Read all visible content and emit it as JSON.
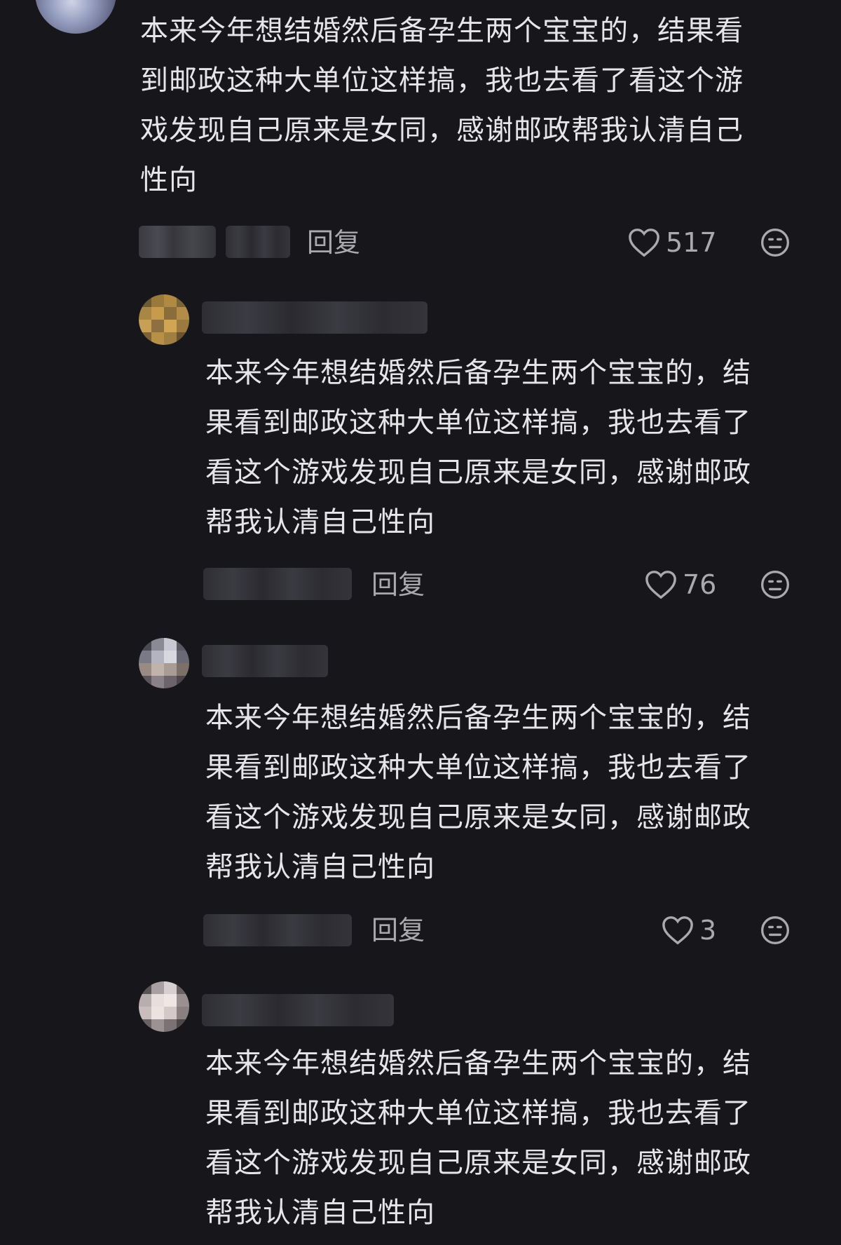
{
  "comments": [
    {
      "text": "本来今年想结婚然后备孕生两个宝宝的，结果看\n到邮政这种大单位这样搞，我也去看了看这个游\n戏发现自己原来是女同，感谢邮政帮我认清自己\n性向",
      "reply_label": "回复",
      "like_count": "517"
    },
    {
      "text": "本来今年想结婚然后备孕生两个宝宝的，结\n果看到邮政这种大单位这样搞，我也去看了\n看这个游戏发现自己原来是女同，感谢邮政\n帮我认清自己性向",
      "reply_label": "回复",
      "like_count": "76"
    },
    {
      "text": "本来今年想结婚然后备孕生两个宝宝的，结\n果看到邮政这种大单位这样搞，我也去看了\n看这个游戏发现自己原来是女同，感谢邮政\n帮我认清自己性向",
      "reply_label": "回复",
      "like_count": "3"
    },
    {
      "text": "本来今年想结婚然后备孕生两个宝宝的，结\n果看到邮政这种大单位这样搞，我也去看了\n看这个游戏发现自己原来是女同，感谢邮政\n帮我认清自己性向"
    }
  ],
  "icons": {
    "like": "heart-outline-icon",
    "dislike": "meh-face-icon"
  },
  "colors": {
    "background": "#17171b",
    "text": "#e6e6e8",
    "muted": "#a9a9ae"
  }
}
